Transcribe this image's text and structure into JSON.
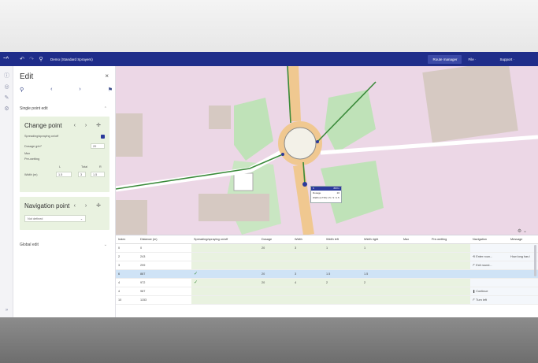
{
  "topbar": {
    "logo": "~^",
    "title": "Demo (Standard Sprayers)",
    "route_manager": "Route manager",
    "file_menu": "File ·",
    "support_menu": "Support ·"
  },
  "panel": {
    "title": "Edit",
    "close": "×",
    "single_point_edit": "Single point edit",
    "change_point": {
      "title": "Change point",
      "nav": "‹ › ✛",
      "spreading_label": "Spreading/spraying on/off",
      "dosage_label": "Dosage g/m²",
      "dosage_value": "20",
      "max_label": "Max",
      "pre_wetting_label": "Pre-wetting",
      "col_left": "L",
      "col_total": "Total",
      "col_right": "R",
      "width_label": "Width (m)",
      "width_left": "1.5",
      "width_total": "3",
      "width_right": "1.5"
    },
    "navigation_point": {
      "title": "Navigation point",
      "nav": "‹ › ✛",
      "select_value": "Not defined",
      "select_arrow": "⌄"
    },
    "global_edit": "Global edit"
  },
  "map_popup": {
    "header_left": "6",
    "header_right": "887m",
    "row1_label": "Dosage",
    "row1_value": "20",
    "row2_label": "Width (L/T/R) 1.5 / 3 / 1.5",
    "row2_value": ""
  },
  "table": {
    "headers": [
      "Index",
      "Distance (m)",
      "Spreading/spraying on/off",
      "Dosage",
      "Width",
      "Width left",
      "Width right",
      "Max",
      "Pre-wetting",
      "Navigation",
      "Message"
    ],
    "rows": [
      {
        "index": "0",
        "distance": "0",
        "spread": "",
        "dosage": "20",
        "width": "3",
        "wleft": "1",
        "wright": "1",
        "max": "",
        "pre": "",
        "nav": "",
        "msg": ""
      },
      {
        "index": "2",
        "distance": "243",
        "spread": "",
        "dosage": "",
        "width": "",
        "wleft": "",
        "wright": "",
        "max": "",
        "pre": "",
        "nav": "⟲ Enter roun...",
        "msg": "How long has i"
      },
      {
        "index": "3",
        "distance": "299",
        "spread": "",
        "dosage": "",
        "width": "",
        "wleft": "",
        "wright": "",
        "max": "",
        "pre": "",
        "nav": "↱ Exit round...",
        "msg": ""
      },
      {
        "index": "6",
        "distance": "887",
        "spread": "✓",
        "dosage": "20",
        "width": "3",
        "wleft": "1.5",
        "wright": "1.5",
        "max": "",
        "pre": "",
        "nav": "",
        "msg": ""
      },
      {
        "index": "4",
        "distance": "972",
        "spread": "✓",
        "dosage": "20",
        "width": "4",
        "wleft": "2",
        "wright": "2",
        "max": "",
        "pre": "",
        "nav": "",
        "msg": ""
      },
      {
        "index": "4",
        "distance": "987",
        "spread": "",
        "dosage": "",
        "width": "",
        "wleft": "",
        "wright": "",
        "max": "",
        "pre": "",
        "nav": "❚ Continue",
        "msg": ""
      },
      {
        "index": "10",
        "distance": "1153",
        "spread": "",
        "dosage": "",
        "width": "",
        "wleft": "",
        "wright": "",
        "max": "",
        "pre": "",
        "nav": "↱ Turn left",
        "msg": ""
      }
    ]
  },
  "colors": {
    "topbar": "#1f2d8a",
    "accent": "#2b3a9b",
    "card_bg": "#e9f2e0",
    "selected_row": "#cfe3f6",
    "map_bg": "#ecd7e6",
    "route": "#3a8a3a",
    "road": "#f0c890"
  },
  "icons": {
    "rail": [
      "info-icon",
      "layers-icon",
      "edit-icon",
      "settings-icon"
    ],
    "tools": [
      "pin-icon",
      "arrow-left-icon",
      "arrow-right-icon",
      "flag-icon"
    ]
  }
}
